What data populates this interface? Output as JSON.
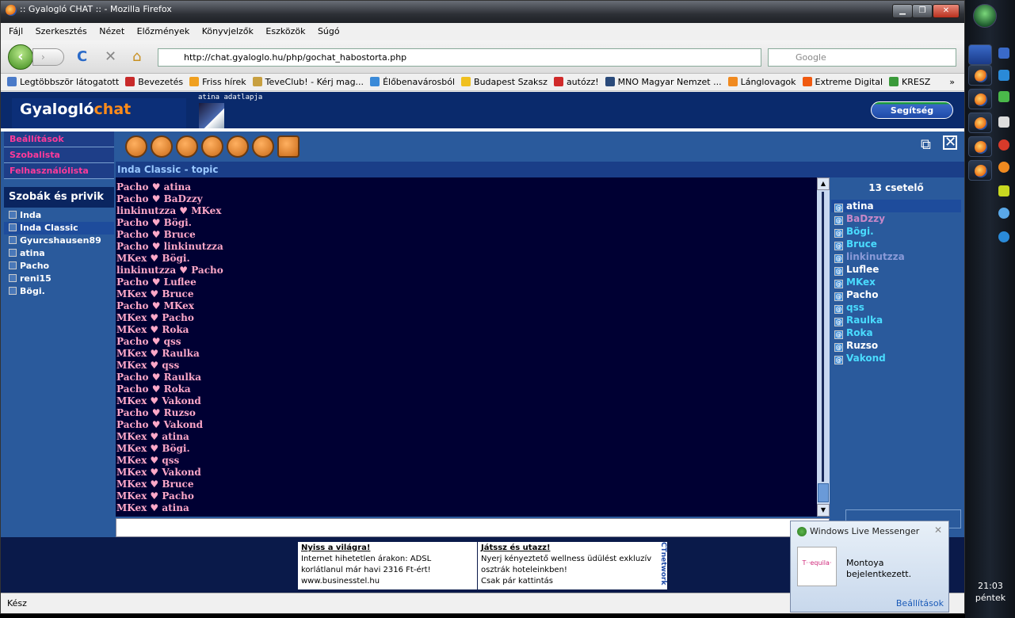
{
  "window": {
    "title": ":: Gyalogló CHAT :: - Mozilla Firefox",
    "minimize": "▁",
    "maximize": "❐",
    "close": "✕"
  },
  "menu": [
    "Fájl",
    "Szerkesztés",
    "Nézet",
    "Előzmények",
    "Könyvjelzők",
    "Eszközök",
    "Súgó"
  ],
  "nav": {
    "url": "http://chat.gyaloglo.hu/php/gochat_habostorta.php",
    "search_placeholder": "Google",
    "back": "‹",
    "fwd": "›",
    "reload": "C",
    "stop": "✕",
    "home": "⌂"
  },
  "bookmarks": [
    {
      "label": "Legtöbbször látogatott",
      "color": "#4a7ac8"
    },
    {
      "label": "Bevezetés",
      "color": "#c82a2a"
    },
    {
      "label": "Friss hírek",
      "color": "#f0a020"
    },
    {
      "label": "TeveClub! - Kérj mag...",
      "color": "#c8a040"
    },
    {
      "label": "Élőbenavárosból",
      "color": "#3a8ad8"
    },
    {
      "label": "Budapest Szaksz",
      "color": "#f0c020"
    },
    {
      "label": "autózz!",
      "color": "#d02a2a"
    },
    {
      "label": "MNO Magyar Nemzet ...",
      "color": "#2a4a7a"
    },
    {
      "label": "Lánglovagok",
      "color": "#f08a20"
    },
    {
      "label": "Extreme Digital",
      "color": "#f05a10"
    },
    {
      "label": "KRESZ",
      "color": "#3a9a3a"
    }
  ],
  "bookmarks_more": "»",
  "header": {
    "logo_a": "Gyalogló",
    "logo_b": "chat",
    "profile_label": "atina adatlapja",
    "help": "Segítség"
  },
  "left_menu": [
    "Beállítások",
    "Szobalista",
    "Felhasználólista"
  ],
  "rooms_title": "Szobák és privik",
  "rooms": [
    {
      "name": "Inda",
      "selected": false
    },
    {
      "name": "Inda Classic",
      "selected": true
    },
    {
      "name": "Gyurcshausen89",
      "selected": false
    },
    {
      "name": "atina",
      "selected": false
    },
    {
      "name": "Pacho",
      "selected": false
    },
    {
      "name": "reni15",
      "selected": false
    },
    {
      "name": "Bögi.",
      "selected": false
    }
  ],
  "topic": "Inda Classic - topic",
  "chat_lines": [
    "Pacho ♥ atina",
    "Pacho ♥ BaDzzy",
    "linkinutzza ♥ MKex",
    "Pacho ♥ Bögi.",
    "Pacho ♥ Bruce",
    "Pacho ♥ linkinutzza",
    "MKex ♥ Bögi.",
    "linkinutzza ♥ Pacho",
    "Pacho ♥ Luflee",
    "MKex ♥ Bruce",
    "Pacho ♥ MKex",
    "MKex ♥ Pacho",
    "MKex ♥ Roka",
    "Pacho ♥ qss",
    "MKex ♥ Raulka",
    "MKex ♥ qss",
    "Pacho ♥ Raulka",
    "Pacho ♥ Roka",
    "MKex ♥ Vakond",
    "Pacho ♥ Ruzso",
    "Pacho ♥ Vakond",
    "MKex ♥ atina",
    "MKex ♥ Bögi.",
    "MKex ♥ qss",
    "MKex ♥ Vakond",
    "MKex ♥ Bruce",
    "MKex ♥ Pacho",
    "MKex ♥ atina"
  ],
  "user_count": "13 csetelő",
  "users": [
    {
      "name": "atina",
      "color": "#ffffff",
      "selected": true
    },
    {
      "name": "BaDzzy",
      "color": "#c888c8",
      "selected": false
    },
    {
      "name": "Bögi.",
      "color": "#4adcff",
      "selected": false
    },
    {
      "name": "Bruce",
      "color": "#4adcff",
      "selected": false
    },
    {
      "name": "linkinutzza",
      "color": "#8a9ad8",
      "selected": false
    },
    {
      "name": "Luflee",
      "color": "#ffffff",
      "selected": false
    },
    {
      "name": "MKex",
      "color": "#4adcff",
      "selected": false
    },
    {
      "name": "Pacho",
      "color": "#ffffff",
      "selected": false
    },
    {
      "name": "qss",
      "color": "#4adcff",
      "selected": false
    },
    {
      "name": "Raulka",
      "color": "#4adcff",
      "selected": false
    },
    {
      "name": "Roka",
      "color": "#4adcff",
      "selected": false
    },
    {
      "name": "Ruzso",
      "color": "#ffffff",
      "selected": false
    },
    {
      "name": "Vakond",
      "color": "#4adcff",
      "selected": false
    }
  ],
  "ads": [
    {
      "title": "Nyiss a világra!",
      "body": "Internet hihetetlen árakon: ADSL korlátlanul már havi 2316 Ft-ért!",
      "link": "www.businesstel.hu"
    },
    {
      "title": "Játssz és utazz!",
      "body": "Nyerj kényeztető wellness üdülést exkluzív osztrák hoteleinkben!",
      "link": "Csak pár kattintás"
    }
  ],
  "ad_network": "CTnetwork",
  "status": "Kész",
  "messenger": {
    "title": "Windows Live Messenger",
    "logo": "T··equila·",
    "line1": "Montoya",
    "line2": "bejelentkezett.",
    "settings": "Beállítások",
    "close": "✕"
  },
  "clock": {
    "time": "21:03",
    "day": "péntek"
  }
}
